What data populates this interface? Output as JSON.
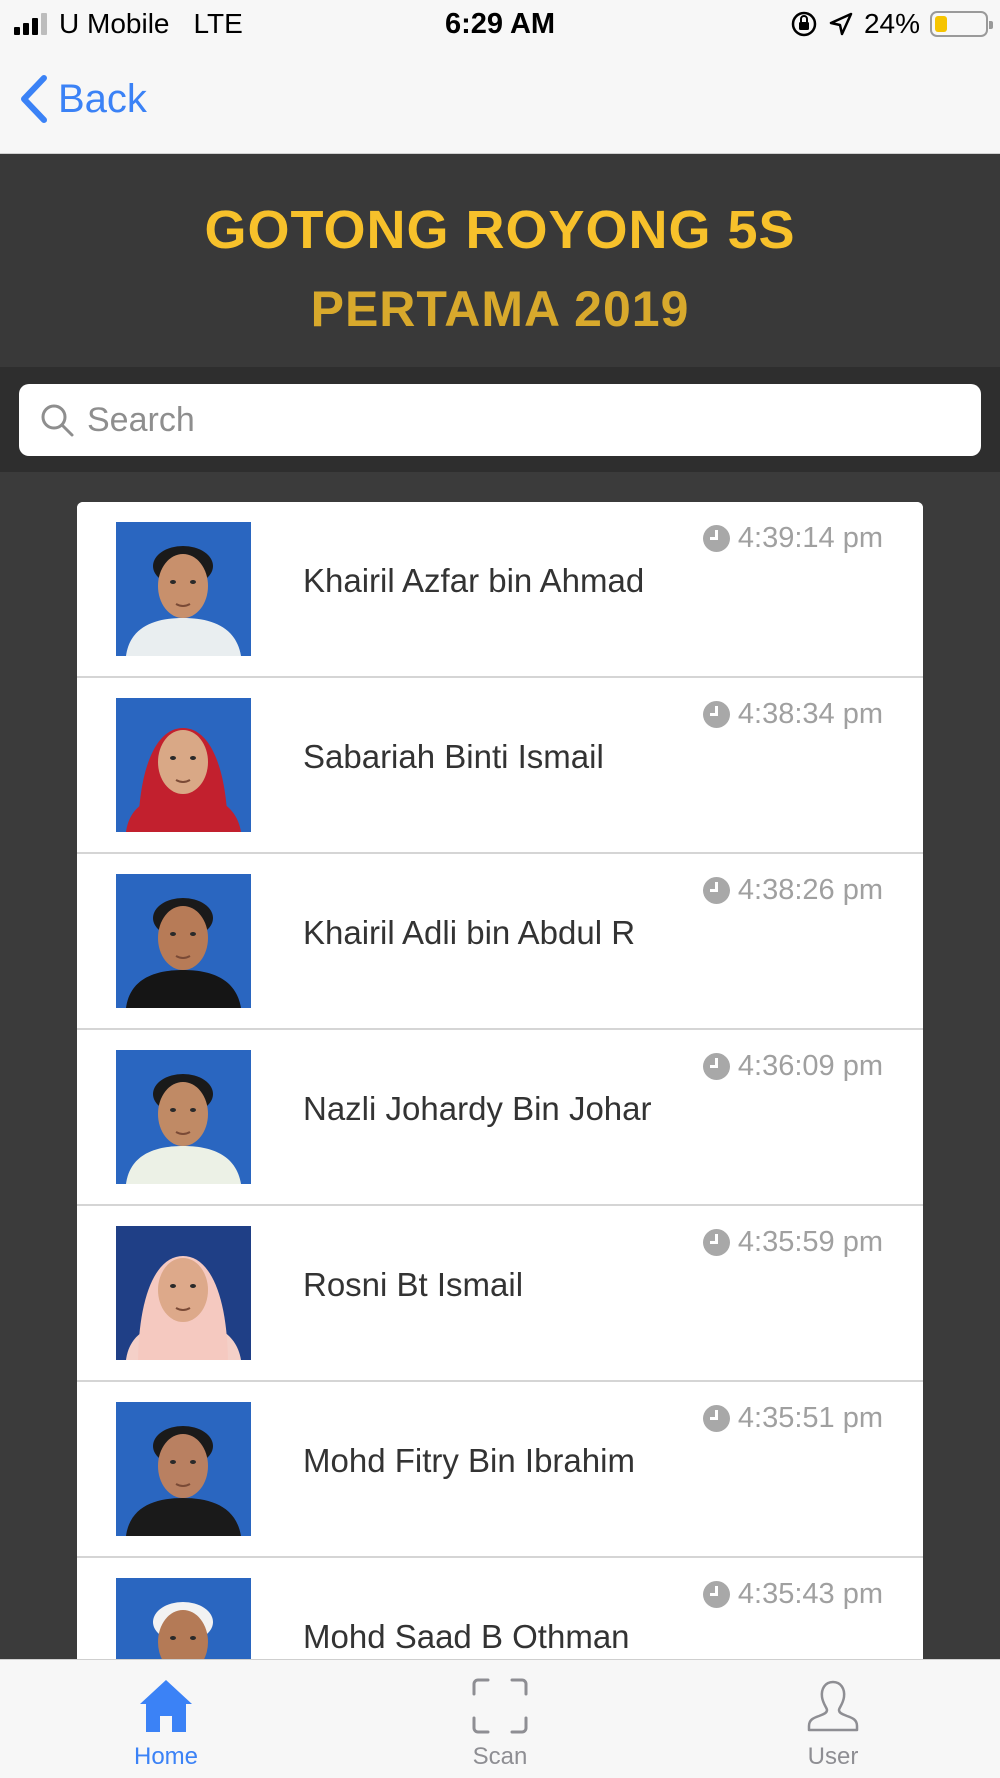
{
  "status_bar": {
    "carrier": "U Mobile",
    "network": "LTE",
    "time": "6:29 AM",
    "battery_percent": "24%",
    "battery_level": 0.24,
    "icons": [
      "signal-icon",
      "rotation-lock-icon",
      "location-arrow-icon",
      "battery-icon"
    ]
  },
  "nav": {
    "back_label": "Back",
    "accent": "#3b82f6"
  },
  "header": {
    "title_line1": "GOTONG ROYONG 5S",
    "title_line2": "PERTAMA 2019",
    "title_color": "#f7c12b",
    "subtitle_color": "#d8a92c"
  },
  "search": {
    "placeholder": "Search",
    "value": ""
  },
  "attendees": [
    {
      "name": "Khairil Azfar bin Ahmad",
      "time": "4:39:14 pm"
    },
    {
      "name": "Sabariah Binti Ismail",
      "time": "4:38:34 pm"
    },
    {
      "name": "Khairil Adli bin Abdul R",
      "time": "4:38:26 pm"
    },
    {
      "name": "Nazli Johardy Bin Johar",
      "time": "4:36:09 pm"
    },
    {
      "name": "Rosni Bt Ismail",
      "time": "4:35:59 pm"
    },
    {
      "name": "Mohd Fitry Bin Ibrahim",
      "time": "4:35:51 pm"
    },
    {
      "name": "Mohd Saad B Othman",
      "time": "4:35:43 pm"
    }
  ],
  "tabs": [
    {
      "label": "Home",
      "icon": "home-icon",
      "active": true
    },
    {
      "label": "Scan",
      "icon": "scan-icon",
      "active": false
    },
    {
      "label": "User",
      "icon": "user-icon",
      "active": false
    }
  ]
}
